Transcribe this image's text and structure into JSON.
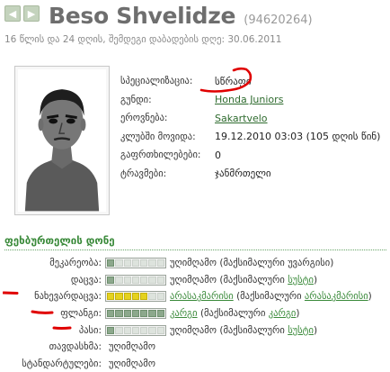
{
  "header": {
    "prev_icon": "arrow-left-icon",
    "next_icon": "arrow-right-icon",
    "name": "Beso Shvelidze",
    "player_id": "(94620264)",
    "subline": "16 წლის და 24 დღის, შემდეგი დაბადების დღე: 30.06.2011"
  },
  "info": [
    {
      "label": "სპეციალიზაცია:",
      "value": "სწრაფი",
      "link": false
    },
    {
      "label": "გუნდი:",
      "value": "Honda Juniors",
      "link": true
    },
    {
      "label": "ეროვნება:",
      "value": "Sakartvelo",
      "link": true
    },
    {
      "label": "კლუბში მოვიდა:",
      "value": "19.12.2010 03:03 (105 დღის წინ)",
      "link": false
    },
    {
      "label": "გაფრთხილებები:",
      "value": "0",
      "link": false
    },
    {
      "label": "ტრავმები:",
      "value": "ჯანმრთელი",
      "link": false
    }
  ],
  "skills_section": {
    "title": "ფეხბურთელის დონე",
    "rows": [
      {
        "label": "მეკარეობა:",
        "level": 1,
        "max": 7,
        "bar": true,
        "word": "უღიმღამო",
        "paren": "(მაქსიმალური",
        "paren_word": "უვარგისი",
        "paren_hl": false,
        "word_hl": false,
        "yellow": false
      },
      {
        "label": "დაცვა:",
        "level": 1,
        "max": 7,
        "bar": true,
        "word": "უღიმღამო",
        "paren": "(მაქსიმალური",
        "paren_word": "სუსტი",
        "paren_hl": true,
        "word_hl": false,
        "yellow": false
      },
      {
        "label": "ნახევარდაცვა:",
        "level": 5,
        "max": 7,
        "bar": true,
        "word": "არასაკმარისი",
        "paren": "(მაქსიმალური",
        "paren_word": "არასაკმარისი",
        "paren_hl": true,
        "word_hl": true,
        "yellow": true
      },
      {
        "label": "ფლანგი:",
        "level": 7,
        "max": 7,
        "bar": true,
        "word": "კარგი",
        "paren": "(მაქსიმალური",
        "paren_word": "კარგი",
        "paren_hl": true,
        "word_hl": true,
        "yellow": false
      },
      {
        "label": "პასი:",
        "level": 1,
        "max": 7,
        "bar": true,
        "word": "უღიმღამო",
        "paren": "(მაქსიმალური",
        "paren_word": "სუსტი",
        "paren_hl": true,
        "word_hl": false,
        "yellow": false
      },
      {
        "label": "თავდასხმა:",
        "level": 0,
        "max": 7,
        "bar": false,
        "word": "უღიმღამო",
        "paren": "",
        "paren_word": "",
        "paren_hl": false,
        "word_hl": false,
        "yellow": false
      },
      {
        "label": "სტანდარტულები:",
        "level": 0,
        "max": 7,
        "bar": false,
        "word": "უღიმღამო",
        "paren": "",
        "paren_word": "",
        "paren_hl": false,
        "word_hl": false,
        "yellow": false
      }
    ]
  },
  "colors": {
    "accent_green": "#3a8a3a",
    "annotation_red": "#e00000",
    "bar_yellow": "#e5d21f"
  }
}
